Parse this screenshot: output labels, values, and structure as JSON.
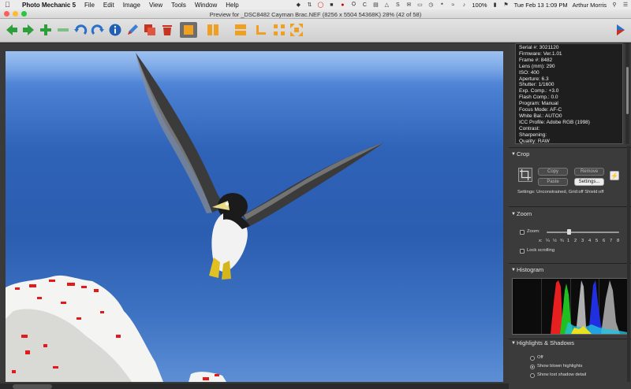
{
  "menubar": {
    "app_name": "Photo Mechanic 5",
    "items": [
      "File",
      "Edit",
      "Image",
      "View",
      "Tools",
      "Window",
      "Help"
    ],
    "battery": "100%",
    "datetime": "Tue Feb 13  1:09 PM",
    "user": "Arthur Morris"
  },
  "window": {
    "title": "Preview for _DSC8482  Cayman Brac.NEF (8256 x 5504 54368K) 28% (42 of 58)"
  },
  "exif": {
    "lines": [
      "Serial #: 3021120",
      "Firmware: Ver.1.01",
      "Frame #: 8482",
      "Lens (mm): 290",
      "ISO: 400",
      "Aperture: 6.3",
      "Shutter: 1/1600",
      "Exp. Comp.: +3.0",
      "Flash Comp.: 0.0",
      "Program: Manual",
      "Focus Mode: AF-C",
      "White Bal.: AUTO0",
      "ICC Profile: Adobe RGB (1998)",
      "Contrast:",
      "Sharpening:",
      "Quality: RAW"
    ]
  },
  "crop": {
    "header": "Crop",
    "copy_label": "Copy",
    "remove_label": "Remove",
    "paste_label": "Paste",
    "settings_label": "Settings...",
    "settings_text": "Settings:  Unconstrained, Grid:off Shield:off"
  },
  "zoom": {
    "header": "Zoom",
    "zoom_label": "Zoom:",
    "scale_prefix": "x:",
    "scale_marks": [
      "¼",
      "½",
      "¾",
      "1",
      "2",
      "3",
      "4",
      "5",
      "6",
      "7",
      "8"
    ],
    "lock_label": "Lock scrolling"
  },
  "histogram": {
    "header": "Histogram"
  },
  "highlights": {
    "header": "Highlights & Shadows",
    "options": [
      {
        "label": "Off",
        "selected": false
      },
      {
        "label": "Show blown highlights",
        "selected": true
      },
      {
        "label": "Show lost shadow detail",
        "selected": false
      }
    ]
  },
  "colors": {
    "accent_orange": "#f0a020",
    "toolbar_green": "#2e9e3a",
    "toolbar_blue": "#2a6fc9",
    "toolbar_red": "#c8321e"
  }
}
